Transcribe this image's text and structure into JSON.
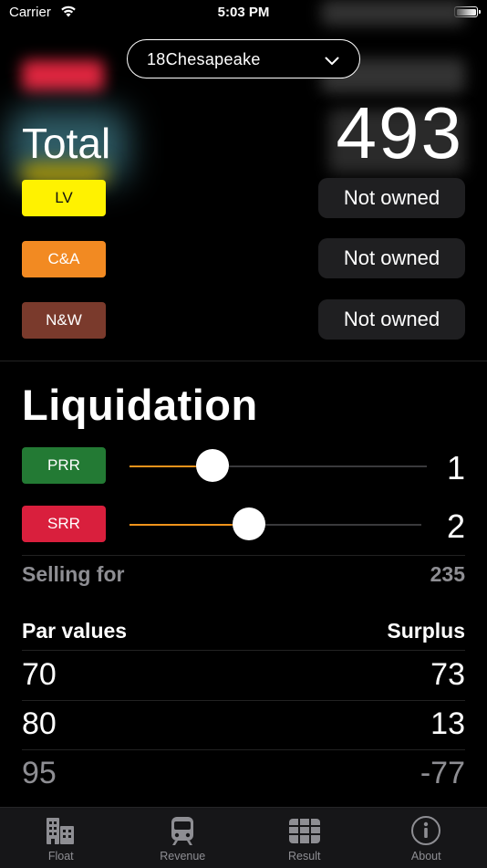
{
  "status_bar": {
    "carrier": "Carrier",
    "time": "5:03 PM"
  },
  "game_selector": {
    "value": "18Chesapeake"
  },
  "total": {
    "label": "Total",
    "value": "493"
  },
  "companies": [
    {
      "name": "LV",
      "bg": "#fff200",
      "fg": "#111111",
      "status": "Not owned"
    },
    {
      "name": "C&A",
      "bg": "#f28a22",
      "fg": "#ffffff",
      "status": "Not owned"
    },
    {
      "name": "N&W",
      "bg": "#7a3a2c",
      "fg": "#ffffff",
      "status": "Not owned"
    }
  ],
  "liquidation": {
    "title": "Liquidation",
    "sliders": [
      {
        "name": "PRR",
        "bg": "#237a34",
        "value": "1",
        "fill": 0.28
      },
      {
        "name": "SRR",
        "bg": "#d91f3d",
        "value": "2",
        "fill": 0.41
      }
    ],
    "selling_for": {
      "label": "Selling for",
      "value": "235"
    },
    "table": {
      "headers": [
        "Par values",
        "Surplus"
      ],
      "rows": [
        {
          "par": "70",
          "surplus": "73"
        },
        {
          "par": "80",
          "surplus": "13"
        },
        {
          "par": "95",
          "surplus": "-77"
        }
      ]
    }
  },
  "tab_bar": {
    "tabs": [
      {
        "label": "Float",
        "icon": "buildings-icon",
        "active": true
      },
      {
        "label": "Revenue",
        "icon": "train-icon",
        "active": false
      },
      {
        "label": "Result",
        "icon": "grid-icon",
        "active": false
      },
      {
        "label": "About",
        "icon": "info-icon",
        "active": false
      }
    ]
  },
  "colors": {
    "accent": "#f0931b",
    "muted": "#8e8e93"
  }
}
